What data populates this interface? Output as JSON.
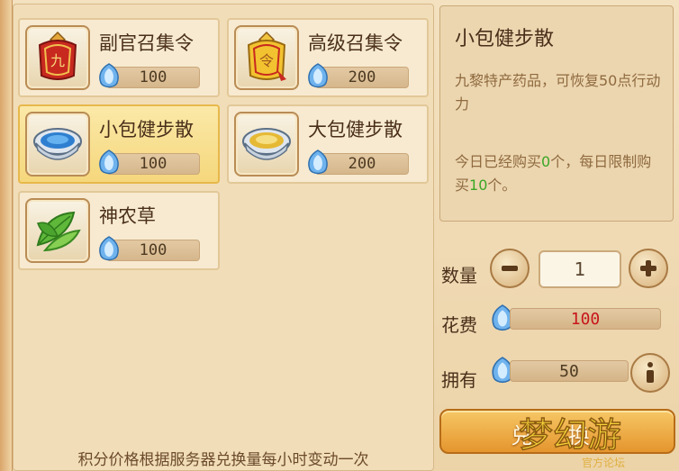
{
  "items": [
    {
      "name": "副官召集令",
      "price": "100",
      "icon": "red-token-icon"
    },
    {
      "name": "高级召集令",
      "price": "200",
      "icon": "gold-token-icon"
    },
    {
      "name": "小包健步散",
      "price": "100",
      "icon": "small-bowl-icon",
      "selected": true
    },
    {
      "name": "大包健步散",
      "price": "200",
      "icon": "large-bowl-icon"
    },
    {
      "name": "神农草",
      "price": "100",
      "icon": "herb-leaf-icon"
    }
  ],
  "footer_note": "积分价格根据服务器兑换量每小时变动一次",
  "detail": {
    "title": "小包健步散",
    "description": "九黎特产药品，可恢复50点行动力",
    "limit_prefix": "今日已经购买",
    "bought_count": "0",
    "limit_middle": "个，每日限制购买",
    "limit_count": "10",
    "limit_suffix": "个。"
  },
  "quantity": {
    "label": "数量",
    "value": "1"
  },
  "cost": {
    "label": "花费",
    "value": "100",
    "color": "#c8161b"
  },
  "owned": {
    "label": "拥有",
    "value": "50"
  },
  "exchange_button": "兑 换",
  "watermark": {
    "brand": "梦幻游",
    "subtitle": "官方论坛"
  },
  "colors": {
    "accent": "#e5952e",
    "gem": "#5a9fe0",
    "green": "#3aa626"
  }
}
